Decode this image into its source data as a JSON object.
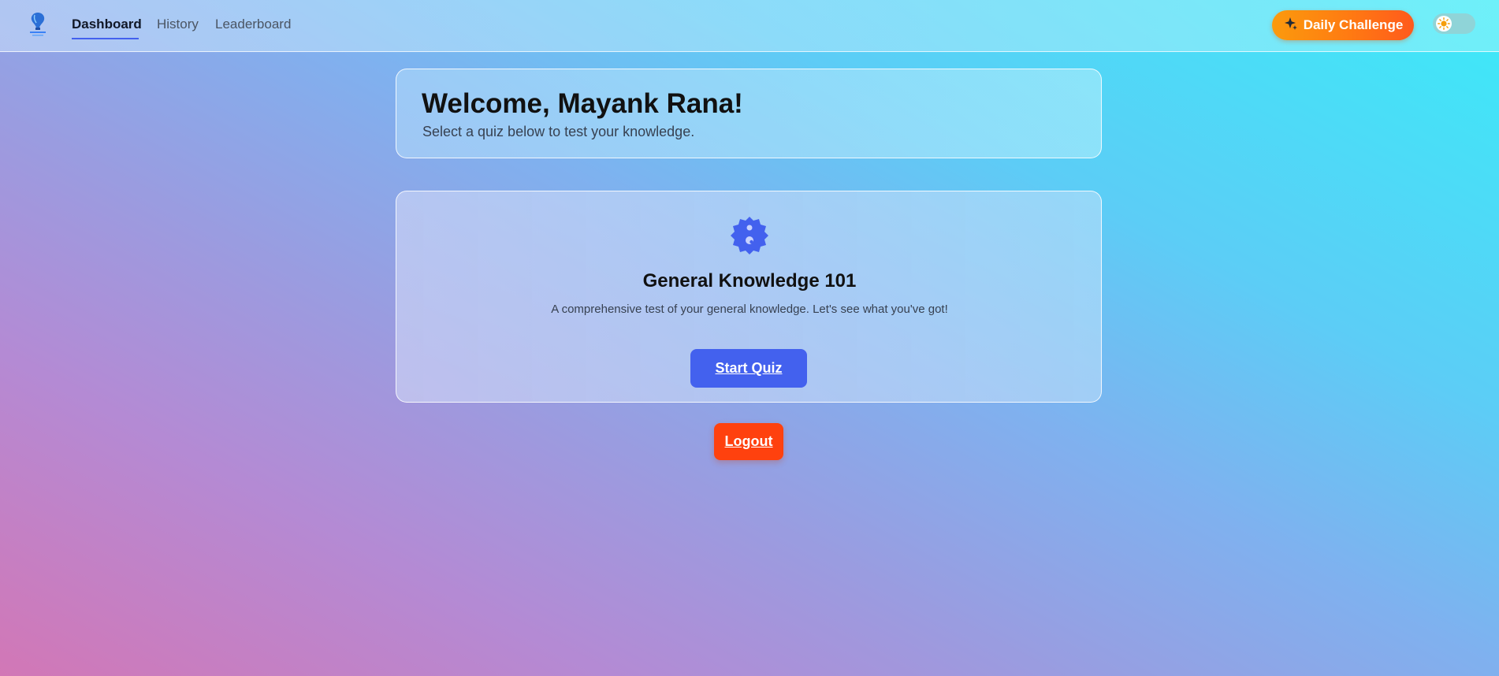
{
  "nav": {
    "links": [
      {
        "label": "Dashboard",
        "active": true
      },
      {
        "label": "History",
        "active": false
      },
      {
        "label": "Leaderboard",
        "active": false
      }
    ],
    "daily_challenge_label": "Daily Challenge",
    "theme_toggle_icon": "sun-icon"
  },
  "welcome": {
    "title": "Welcome, Mayank Rana!",
    "subtitle": "Select a quiz below to test your knowledge."
  },
  "quiz": {
    "icon": "quiz-badge-icon",
    "title": "General Knowledge 101",
    "description": "A comprehensive test of your general knowledge. Let's see what you've got!",
    "start_label": "Start Quiz"
  },
  "logout_label": "Logout",
  "colors": {
    "accent": "#4361ee",
    "logout": "#ff410e",
    "daily_challenge_start": "#fb9a0d",
    "daily_challenge_end": "#ff5a1c"
  }
}
